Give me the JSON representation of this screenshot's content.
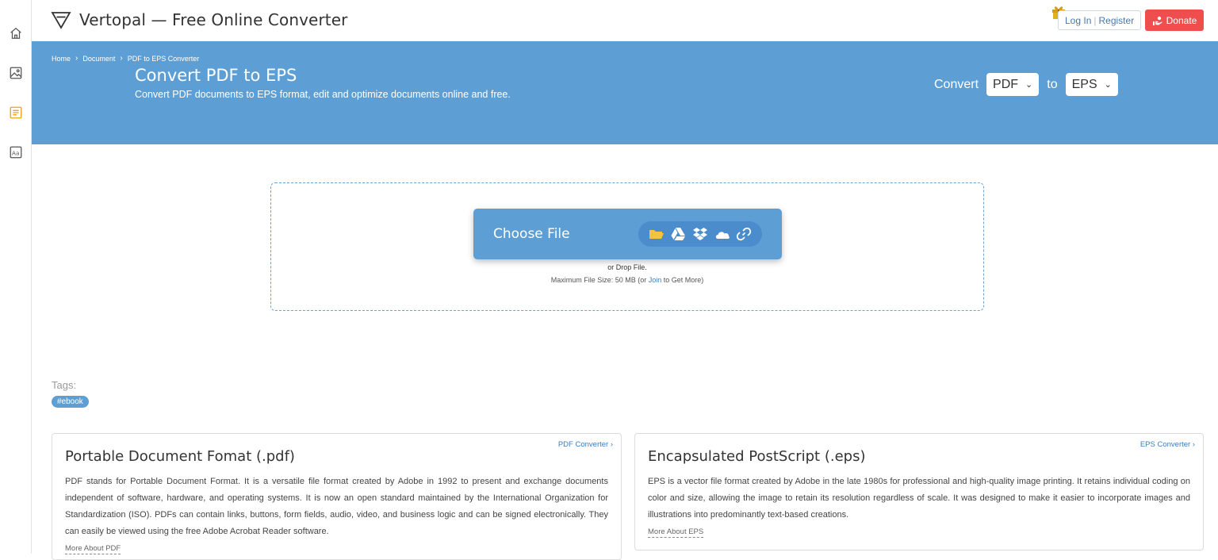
{
  "sidebar": {
    "items": [
      {
        "icon": "home-icon"
      },
      {
        "icon": "image-icon"
      },
      {
        "icon": "document-icon",
        "active": true,
        "color": "#f0a020"
      },
      {
        "icon": "font-icon"
      }
    ]
  },
  "header": {
    "brand_title": "Vertopal — Free Online Converter",
    "login_label": "Log In",
    "separator": "|",
    "register_label": "Register",
    "donate_label": "Donate",
    "donate_color": "#ef4e4e",
    "gift_icon": "gift-icon"
  },
  "hero": {
    "background_color": "#5d9fd5",
    "breadcrumb": [
      "Home",
      "Document",
      "PDF to EPS Converter"
    ],
    "title": "Convert PDF to EPS",
    "subtitle": "Convert PDF documents to EPS format, edit and optimize documents online and free.",
    "convert_label": "Convert",
    "from_format": "PDF",
    "to_label": "to",
    "to_format": "EPS"
  },
  "upload": {
    "choose_label": "Choose File",
    "sources": [
      "folder-icon",
      "google-drive-icon",
      "dropbox-icon",
      "onedrive-icon",
      "link-icon"
    ],
    "drop_text": "or Drop File.",
    "max_prefix": "Maximum File Size: 50 MB (or ",
    "join_label": "Join",
    "max_suffix": " to Get More)"
  },
  "tags": {
    "label": "Tags:",
    "items": [
      "#ebook"
    ]
  },
  "cards": {
    "pdf": {
      "link": "PDF Converter ›",
      "title": "Portable Document Fomat (.pdf)",
      "body": "PDF stands for Portable Document Format. It is a versatile file format created by Adobe in 1992 to present and exchange documents independent of software, hardware, and operating systems. It is now an open standard maintained by the International Organization for Standardization (ISO). PDFs can contain links, buttons, form fields, audio, video, and business logic and can be signed electronically. They can easily be viewed using the free Adobe Acrobat Reader software.",
      "more": "More About PDF"
    },
    "eps": {
      "link": "EPS Converter ›",
      "title": "Encapsulated PostScript (.eps)",
      "body": "EPS is a vector file format created by Adobe in the late 1980s for professional and high-quality image printing. It retains individual coding on color and size, allowing the image to retain its resolution regardless of scale. It was designed to make it easier to incorporate images and illustrations into predominantly text-based creations.",
      "more": "More About EPS"
    }
  }
}
